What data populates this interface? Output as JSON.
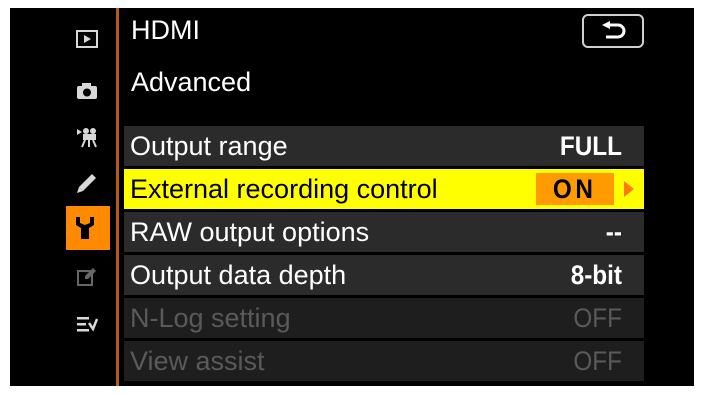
{
  "header": {
    "title": "HDMI",
    "subtitle": "Advanced"
  },
  "sidebar": {
    "icons": [
      "playback-icon",
      "photo-shooting-icon",
      "movie-shooting-icon",
      "custom-settings-pencil-icon",
      "setup-wrench-icon",
      "retouch-icon",
      "my-menu-icon"
    ],
    "active": "setup-wrench-icon"
  },
  "menu": {
    "items": [
      {
        "label": "Output range",
        "value": "FULL",
        "state": "normal"
      },
      {
        "label": "External recording control",
        "value": "ON",
        "state": "selected"
      },
      {
        "label": "RAW output options",
        "value": "--",
        "state": "normal"
      },
      {
        "label": "Output data depth",
        "value": "8-bit",
        "state": "normal"
      },
      {
        "label": "N-Log setting",
        "value": "OFF",
        "state": "disabled"
      },
      {
        "label": "View assist",
        "value": "OFF",
        "state": "disabled"
      }
    ]
  },
  "colors": {
    "highlight": "#ffff00",
    "value_box": "#ff9a00",
    "accent": "#ff8a00",
    "divider": "#b85a16"
  }
}
